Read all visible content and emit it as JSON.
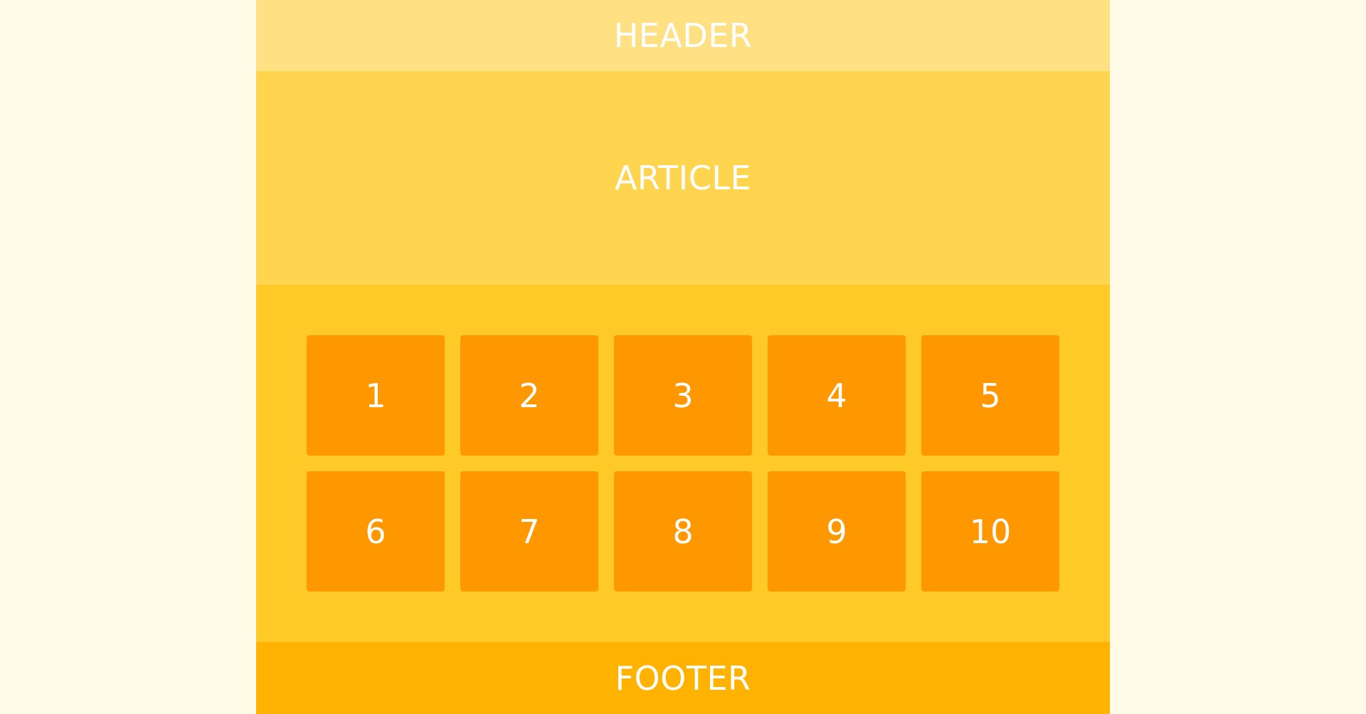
{
  "header": {
    "label": "HEADER"
  },
  "article": {
    "label": "ARTICLE"
  },
  "grid": {
    "items": [
      "1",
      "2",
      "3",
      "4",
      "5",
      "6",
      "7",
      "8",
      "9",
      "10"
    ]
  },
  "footer": {
    "label": "FOOTER"
  },
  "colors": {
    "background": "#fffbe6",
    "header": "#ffe083",
    "article": "#ffd54f",
    "grid_section": "#ffca28",
    "tile": "#ff9800",
    "footer": "#ffb300",
    "text": "#ffffff"
  }
}
